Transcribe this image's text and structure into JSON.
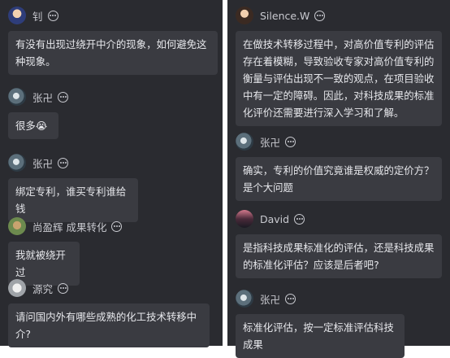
{
  "left": {
    "messages": [
      {
        "user": "钊",
        "text": "有没有出现过绕开中介的现象，如何避免这种现象。"
      },
      {
        "user": "张卍",
        "text": "很多😭"
      },
      {
        "user": "张卍",
        "text": "绑定专利，谁买专利谁给钱"
      },
      {
        "user": "尚盈辉 成果转化",
        "text": "我就被绕开过"
      },
      {
        "user": "源究",
        "text": "请问国内外有哪些成熟的化工技术转移中介?"
      }
    ]
  },
  "right": {
    "messages": [
      {
        "user": "Silence.W",
        "text": "在做技术转移过程中，对高价值专利的评估存在着模糊，导致验收专家对高价值专利的衡量与评估出现不一致的观点，在项目验收中有一定的障碍。因此，对科技成果的标准化评价还需要进行深入学习和了解。"
      },
      {
        "user": "张卍",
        "text": "确实，专利的价值究竟谁是权威的定价方？是个大问题"
      },
      {
        "user": "David",
        "text": "是指科技成果标准化的评估，还是科技成果的标准化评估？应该是后者吧?"
      },
      {
        "user": "张卍",
        "text": "标准化评估，按一定标准评估科技成果"
      }
    ]
  }
}
